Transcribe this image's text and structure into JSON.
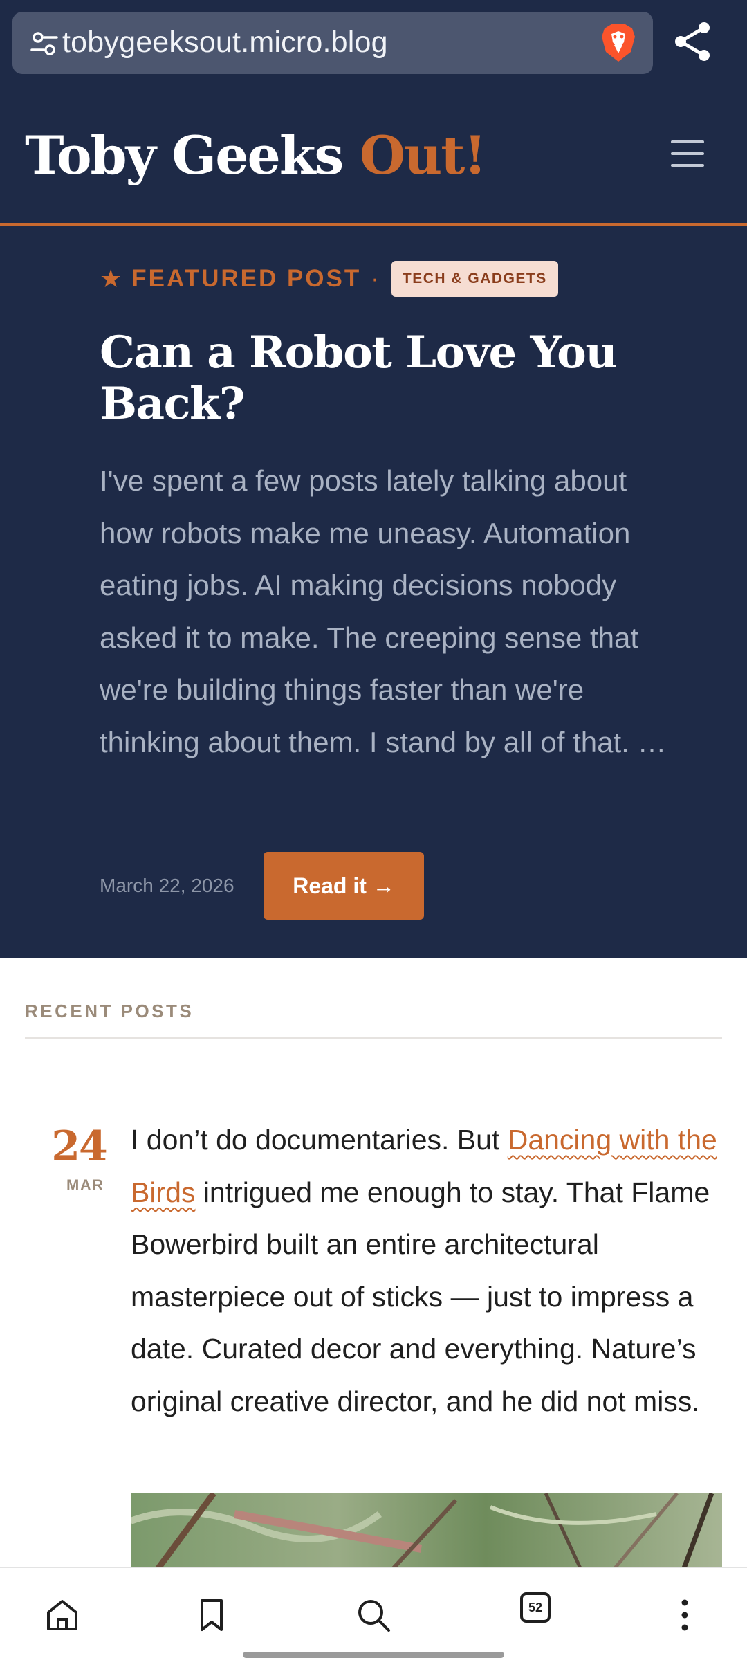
{
  "browser": {
    "url": "tobygeeksout.micro.blog",
    "tab_count": "52"
  },
  "site": {
    "title_main": "Toby Geeks",
    "title_accent": "Out!"
  },
  "featured": {
    "kicker": "FEATURED POST",
    "separator": "·",
    "tag": "TECH & GADGETS",
    "title": "Can a Robot Love You Back?",
    "excerpt": "I've spent a few posts lately talking about how robots make me uneasy. Automation eating jobs. AI making decisions nobody asked it to make. The creeping sense that we're building things faster than we're thinking about them. I stand by all of that. …",
    "date": "March 22, 2026",
    "read_label": "Read it →"
  },
  "recent": {
    "heading": "RECENT POSTS",
    "posts": [
      {
        "day": "24",
        "month": "MAR",
        "text_before": "I don’t do documentaries. But ",
        "link_text": "Dancing with the Birds",
        "text_after": " intrigued me enough to stay. That Flame Bowerbird built an entire architectural masterpiece out of sticks — just to impress a date. Curated decor and everything. Nature’s original creative director, and he did not miss."
      }
    ]
  },
  "colors": {
    "navy": "#1e2a47",
    "accent": "#c9692f"
  },
  "icons": [
    "tune-icon",
    "brave-lion-icon",
    "share-icon",
    "menu-icon",
    "home-icon",
    "bookmark-icon",
    "search-icon",
    "tabs-icon",
    "more-vert-icon"
  ]
}
